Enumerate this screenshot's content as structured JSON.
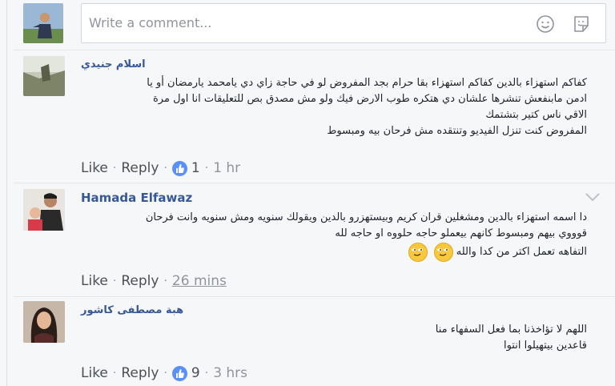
{
  "composer": {
    "placeholder": "Write a comment..."
  },
  "comments": [
    {
      "author": "اسلام جنيدي",
      "lines": [
        "كفاكم استهزاء بالدين كفاكم استهزاء بقا حرام بجد المفروض لو في حاجة زاي دي يامحمد يارمضان أو يا",
        "ادمن مابنفعش تنشرها علشان دي هتكره طوب الارض فيك ولو مش مصدق بص للتعليقات انا اول مرة",
        "الاقي ناس كتير بتشتمك",
        "المفروض كنت تنزل الفيديو وتنتقده مش فرحان بيه ومبسوط"
      ],
      "like": "Like",
      "reply": "Reply",
      "reactions": "1",
      "time": "1 hr"
    },
    {
      "author": "Hamada Elfawaz",
      "lines": [
        "دا اسمه استهزاء بالدين ومشغلين قران كريم وبيستهزرو بالدين ويقولك سنويه ومش سنويه وانت فرحان",
        "قوووي بيهم ومبسوط كانهم بيعملو حاجه حلووه او حاجه لله",
        "التفاهه تعمل اكتر من كدا والله"
      ],
      "like": "Like",
      "reply": "Reply",
      "time": "26 mins"
    },
    {
      "author": "هبة مصطفى كاشور",
      "lines": [
        "اللهم لا تؤاخذنا بما فعل السفهاء منا",
        "قاعدين بيتهيلوا انتوا"
      ],
      "like": "Like",
      "reply": "Reply",
      "reactions": "9",
      "time": "3 hrs"
    }
  ],
  "colors": {
    "link": "#365899",
    "like_badge": "#5890ff",
    "meta": "#90949c",
    "background": "#f6f7f9"
  },
  "icons": [
    "emoji-icon",
    "sticker-icon",
    "like-icon",
    "chevron-down-icon",
    "emoji-smirk-icon"
  ]
}
